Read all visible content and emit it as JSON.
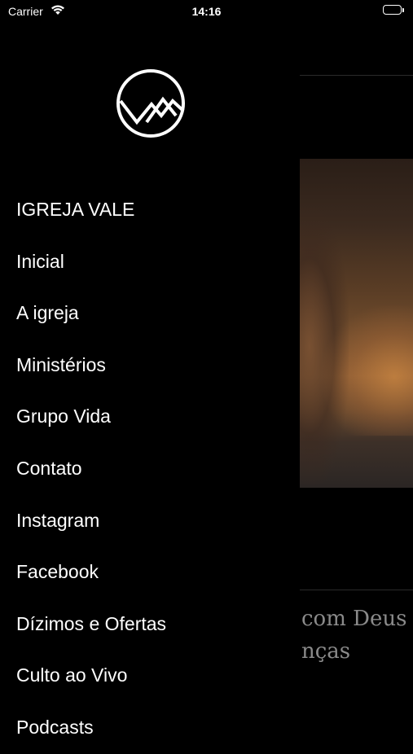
{
  "status_bar": {
    "carrier": "Carrier",
    "time": "14:16",
    "icons": [
      "wifi-icon",
      "battery-icon"
    ]
  },
  "drawer": {
    "logo": "igreja-vale-logo",
    "menu_items": [
      {
        "label": "IGREJA VALE"
      },
      {
        "label": "Inicial"
      },
      {
        "label": "A igreja"
      },
      {
        "label": "Ministérios"
      },
      {
        "label": "Grupo Vida"
      },
      {
        "label": "Contato"
      },
      {
        "label": "Instagram"
      },
      {
        "label": "Facebook"
      },
      {
        "label": "Dízimos e Ofertas"
      },
      {
        "label": "Culto ao Vivo"
      },
      {
        "label": "Podcasts"
      }
    ]
  },
  "content": {
    "post_title_line_1": "com Deus",
    "post_title_line_2": "nças"
  },
  "colors": {
    "background": "#000000",
    "text": "#ffffff",
    "muted_text": "#8a8a8a"
  }
}
